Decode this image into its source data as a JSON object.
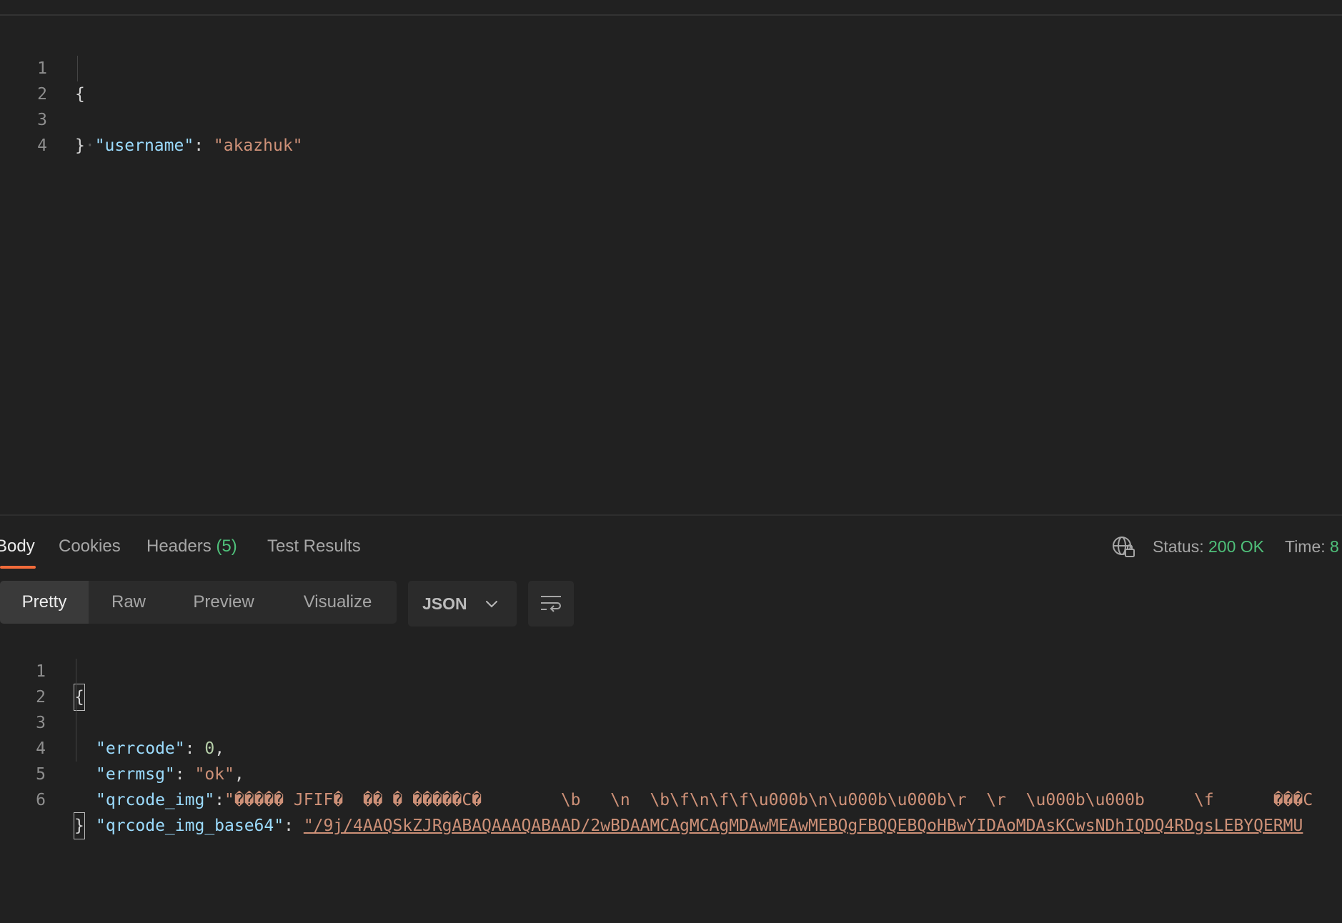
{
  "request_body": {
    "lines": [
      {
        "num": "1",
        "text": "{"
      },
      {
        "num": "2",
        "key": "\"username\"",
        "sep": ": ",
        "value": "\"akazhuk\""
      },
      {
        "num": "3",
        "text": "}"
      },
      {
        "num": "4",
        "text": ""
      }
    ]
  },
  "response": {
    "tabs": [
      {
        "label": "Body"
      },
      {
        "label": "Cookies"
      },
      {
        "label": "Headers",
        "count": "(5)"
      },
      {
        "label": "Test Results"
      }
    ],
    "status_label": "Status:",
    "status_value": "200 OK",
    "time_label": "Time:",
    "time_value": "8",
    "view_modes": [
      "Pretty",
      "Raw",
      "Preview",
      "Visualize"
    ],
    "format": "JSON",
    "lines": [
      {
        "num": "1",
        "text": "{"
      },
      {
        "num": "2",
        "key": "\"errcode\"",
        "sep": ": ",
        "value": "0",
        "tail": ","
      },
      {
        "num": "3",
        "key": "\"errmsg\"",
        "sep": ": ",
        "value": "\"ok\"",
        "tail": ","
      },
      {
        "num": "4",
        "key": "\"qrcode_img\"",
        "sep": ":",
        "value": "\"����� JFIF�  �� � �����C�        \\b   \\n  \\b\\f\\n\\f\\f\\u000b\\n\\u000b\\u000b\\r  \\r  \\u000b\\u000b     \\f      ���C"
      },
      {
        "num": "5",
        "key": "\"qrcode_img_base64\"",
        "sep": ": ",
        "value": "\"/9j/4AAQSkZJRgABAQAAAQABAAD/2wBDAAMCAgMCAgMDAwMEAwMEBQgFBQQEBQoHBwYIDAoMDAsKCwsNDhIQDQ4RDgsLEBYQERMU"
      },
      {
        "num": "6",
        "text": "}"
      }
    ]
  },
  "colors": {
    "background": "#212121",
    "accent": "#f26b3a",
    "status_ok": "#4fc07a",
    "json_key": "#9cdcfe",
    "json_string": "#ce9178",
    "json_number": "#b5cea8"
  },
  "icons": [
    "globe-lock-icon",
    "chevron-down-icon",
    "wrap-lines-icon"
  ]
}
